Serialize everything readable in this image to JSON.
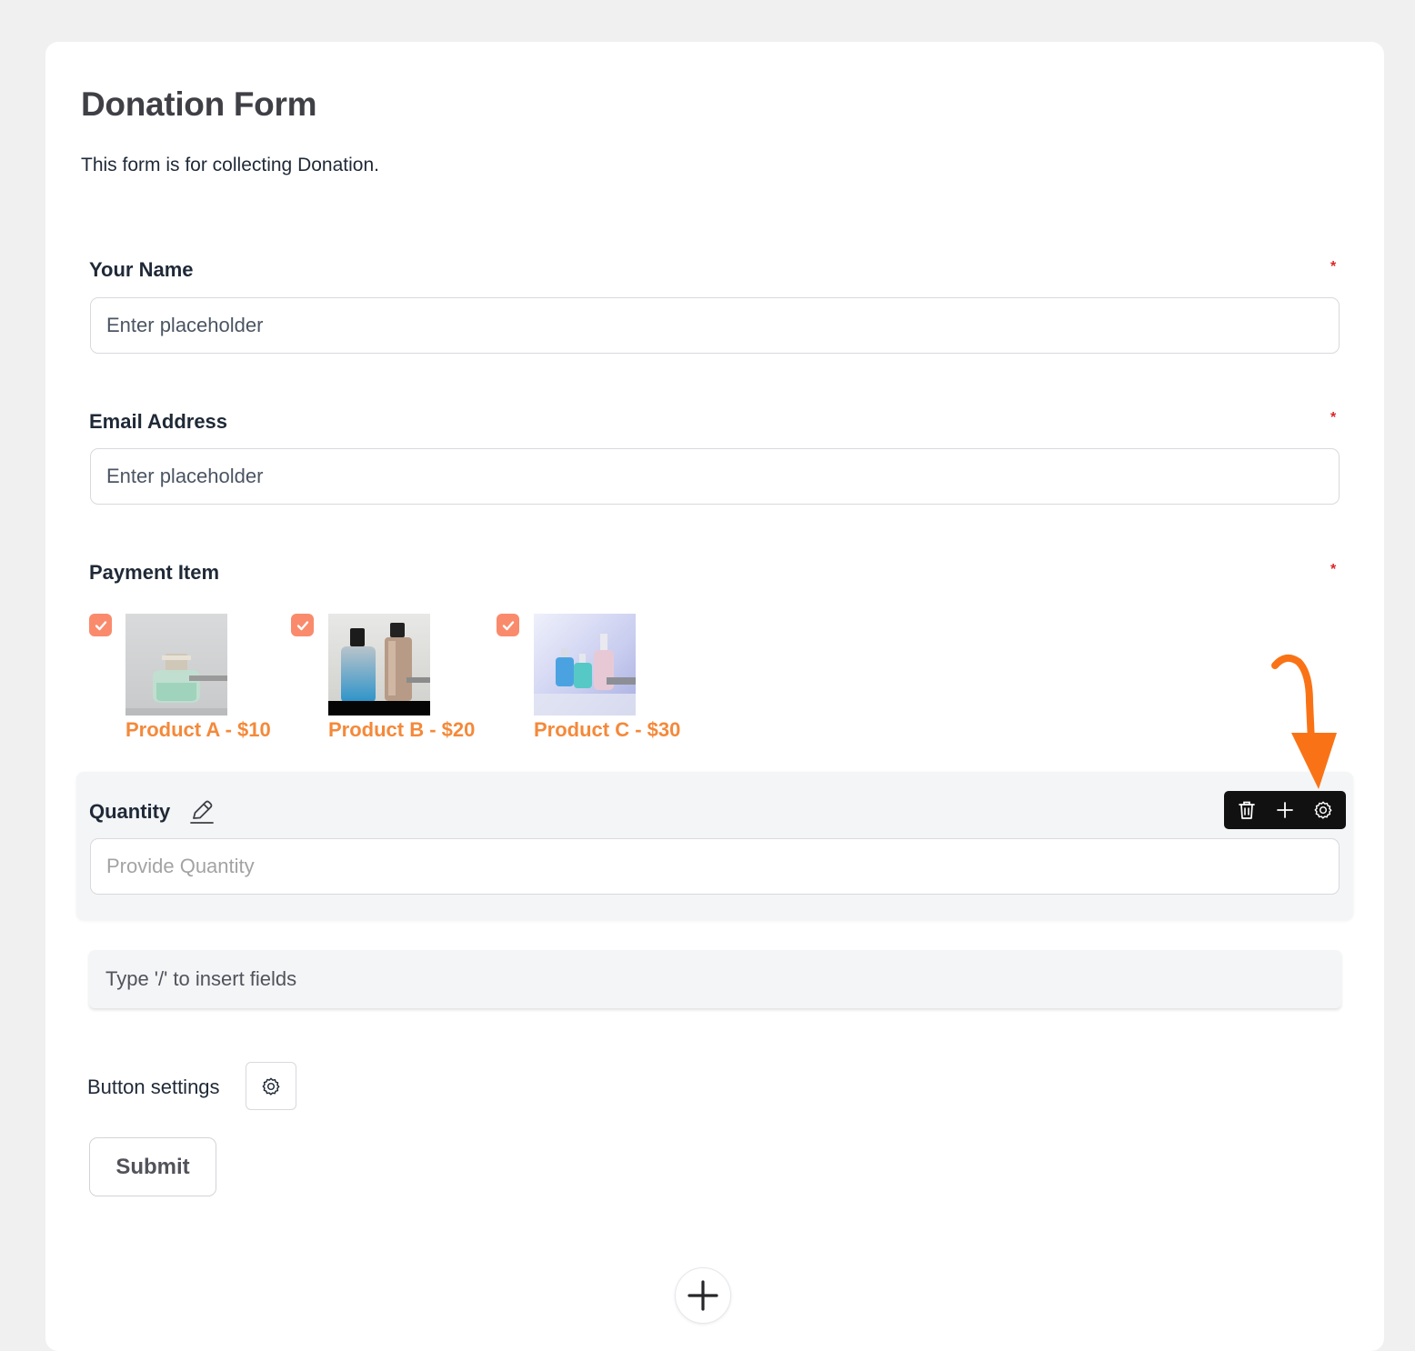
{
  "form": {
    "title": "Donation Form",
    "description": "This form is for collecting Donation."
  },
  "fields": {
    "name": {
      "label": "Your Name",
      "required_mark": "*",
      "placeholder": "Enter placeholder"
    },
    "email": {
      "label": "Email Address",
      "required_mark": "*",
      "placeholder": "Enter placeholder"
    },
    "payment": {
      "label": "Payment Item",
      "required_mark": "*",
      "items": [
        {
          "label": "Product A - $10",
          "checked": true
        },
        {
          "label": "Product B - $20",
          "checked": true
        },
        {
          "label": "Product C - $30",
          "checked": true
        }
      ]
    },
    "quantity": {
      "label": "Quantity",
      "placeholder": "Provide Quantity"
    }
  },
  "toolbar": {
    "icons": [
      "trash-icon",
      "plus-icon",
      "gear-icon"
    ]
  },
  "inserter": {
    "text": "Type '/' to insert fields"
  },
  "button_settings": {
    "label": "Button settings"
  },
  "submit": {
    "label": "Submit"
  },
  "colors": {
    "accent": "#f4893a",
    "checkbox": "#f98b6c",
    "required": "#dc2626",
    "annotation_arrow": "#f97316",
    "toolbar_bg": "#111111"
  }
}
